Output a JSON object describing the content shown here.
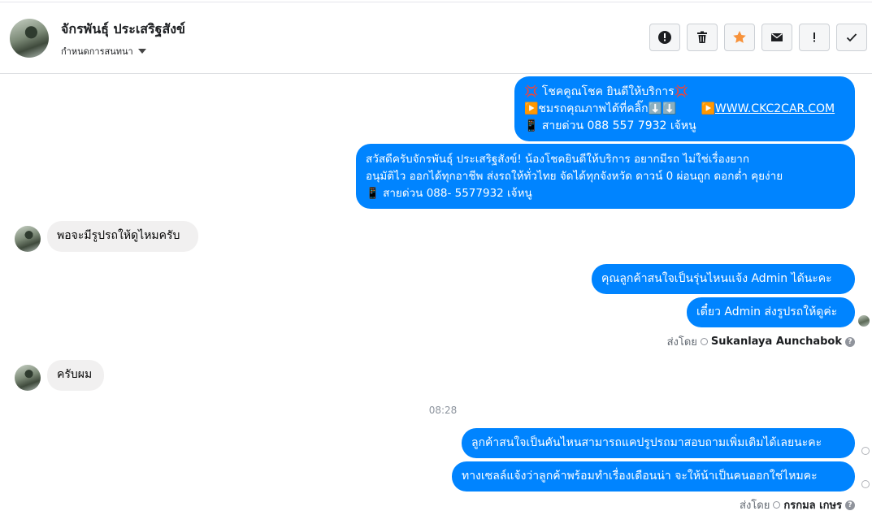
{
  "header": {
    "contact_name": "จักรพันธุ์ ประเสริฐสังข์",
    "label_selector": "กำหนดการสนทนา",
    "actions": [
      "mark-spam",
      "delete",
      "star",
      "mark-unread",
      "important",
      "done"
    ]
  },
  "messages": {
    "m1": {
      "line1": "💢 โชคคูณโชค ยินดีให้บริการ💢",
      "line2a": "▶️ชมรถคุณภาพได้ที่คลิ๊ก⬇️⬇️",
      "line2b": "▶️",
      "link": "WWW.CKC2CAR.COM",
      "line3": "📱 สายด่วน 088 557 7932 เจ้หนู"
    },
    "m2": {
      "line1": "สวัสดีครับจักรพันธุ์ ประเสริฐสังข์! น้องโชคยินดีให้บริการ อยากมีรถ ไม่ใช่เรื่องยาก",
      "line2": "อนุมัติไว ออกได้ทุกอาชีพ ส่งรถให้ทั่วไทย จัดได้ทุกจังหวัด ดาวน์ 0  ผ่อนถูก ดอกต่ำ คุยง่าย",
      "line3": "📱 สายด่วน 088- 5577932 เจ้หนู"
    },
    "m3": "พอจะมีรูปรถให้ดูไหมครับ",
    "m4": "คุณลูกค้าสนใจเป็นรุ่นไหนแจ้ง Admin ได้นะคะ",
    "m5": "เดี๋ยว Admin ส่งรูปรถให้ดูค่ะ",
    "sent_by_1": {
      "prefix": "ส่งโดย",
      "name": "Sukanlaya Aunchabok",
      "help": "?"
    },
    "m6": "ครับผม",
    "timestamp": "08:28",
    "m7": "ลูกค้าสนใจเป็นคันไหนสามารถแคปรูปรถมาสอบถามเพิ่มเติมได้เลยนะคะ",
    "m8": "ทางเซลล์แจ้งว่าลูกค้าพร้อมทำเรื่องเดือนน่า จะให้น้าเป็นคนออกใช่ไหมคะ",
    "sent_by_2": {
      "prefix": "ส่งโดย",
      "name": "กรกมล เกษร",
      "help": "?"
    }
  },
  "colors": {
    "outgoing_bubble": "#0084ff",
    "incoming_bubble": "#f1f0f0",
    "star": "#f7923b"
  }
}
